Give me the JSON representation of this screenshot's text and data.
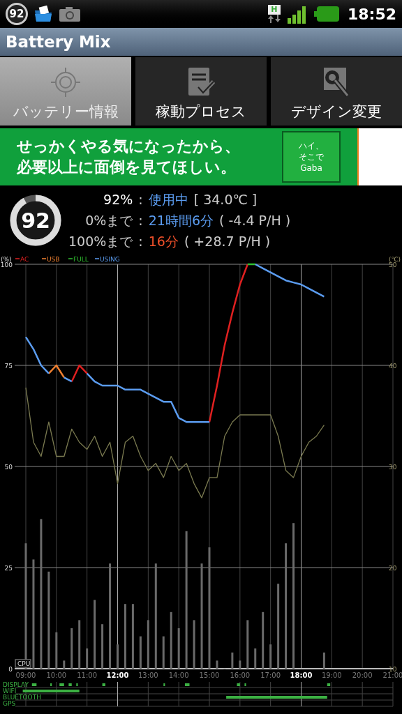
{
  "status_bar": {
    "battery_badge": "92",
    "network_badge": "H",
    "time": "18:52"
  },
  "app_bar": {
    "title": "Battery Mix"
  },
  "tabs": [
    {
      "label": "バッテリー情報",
      "selected": true,
      "kind": "target"
    },
    {
      "label": "稼動プロセス",
      "selected": false,
      "kind": "checklist"
    },
    {
      "label": "デザイン変更",
      "selected": false,
      "kind": "wrench"
    }
  ],
  "ad": {
    "lines": [
      "せっかくやる気になったから、",
      "必要以上に面倒を見てほしい。"
    ],
    "box_lines": [
      "ハイ、",
      "そこで",
      "Gaba"
    ]
  },
  "info": {
    "gauge": {
      "value": "92",
      "level": 0.92
    },
    "rows": [
      {
        "label": "92%",
        "separator": ":",
        "value": "使用中",
        "color": "#5b9cf0",
        "detail": "[ 34.0℃ ]"
      },
      {
        "label": "0%まで",
        "separator": ":",
        "value": "21時間6分",
        "color": "#5b9cf0",
        "detail": "( -4.4 P/H )"
      },
      {
        "label": "100%まで",
        "separator": ":",
        "value": "16分",
        "color": "#f0502a",
        "detail": "( +28.7 P/H )"
      }
    ]
  },
  "chart": {
    "ylabel": "(%)",
    "y2label": "(℃)",
    "lanes": [
      "DISPLAY",
      "WIFI",
      "BLUETOOTH",
      "GPS"
    ],
    "chart_data": {
      "type": "line",
      "grid": true,
      "legend": "top-left",
      "xlim": [
        9,
        21
      ],
      "ylim": [
        0,
        100
      ],
      "y2lim": [
        10,
        50
      ],
      "yticks": [
        0,
        25,
        50,
        75,
        100
      ],
      "y2ticks": [
        10,
        20,
        30,
        40,
        50
      ],
      "xticks": [
        {
          "value": 9,
          "label": "09:00"
        },
        {
          "value": 10,
          "label": "10:00"
        },
        {
          "value": 11,
          "label": "11:00"
        },
        {
          "value": 12,
          "label": "12:00"
        },
        {
          "value": 13,
          "label": "13:00"
        },
        {
          "value": 14,
          "label": "14:00"
        },
        {
          "value": 15,
          "label": "15:00"
        },
        {
          "value": 16,
          "label": "16:00"
        },
        {
          "value": 17,
          "label": "17:00"
        },
        {
          "value": 18,
          "label": "18:00"
        },
        {
          "value": 19,
          "label": "19:00"
        },
        {
          "value": 20,
          "label": "20:00"
        },
        {
          "value": 21,
          "label": "21:00"
        }
      ],
      "x": [
        9,
        9.25,
        9.5,
        9.75,
        10,
        10.25,
        10.5,
        10.75,
        11,
        11.25,
        11.5,
        11.75,
        12,
        12.25,
        12.5,
        12.75,
        13,
        13.25,
        13.5,
        13.75,
        14,
        14.25,
        14.5,
        14.75,
        15,
        15.25,
        15.5,
        15.75,
        16,
        16.25,
        16.5,
        16.75,
        17,
        17.25,
        17.5,
        17.75,
        18,
        18.25,
        18.5,
        18.75
      ],
      "series": [
        {
          "name": "AC",
          "color": "#e02020",
          "values": [
            null,
            null,
            null,
            null,
            null,
            null,
            71,
            75,
            73,
            null,
            null,
            null,
            null,
            null,
            null,
            null,
            null,
            null,
            null,
            null,
            null,
            null,
            null,
            null,
            61,
            70,
            80,
            88,
            95,
            100,
            null,
            null,
            null,
            null,
            null,
            null,
            null,
            null,
            null,
            null
          ]
        },
        {
          "name": "USB",
          "color": "#f08030",
          "values": [
            null,
            null,
            null,
            73,
            75,
            72,
            null,
            null,
            null,
            null,
            null,
            null,
            null,
            null,
            null,
            null,
            null,
            null,
            null,
            null,
            null,
            null,
            null,
            null,
            null,
            null,
            null,
            null,
            null,
            null,
            null,
            null,
            null,
            null,
            null,
            null,
            null,
            null,
            null,
            null
          ]
        },
        {
          "name": "FULL",
          "color": "#30c030",
          "values": [
            null,
            null,
            null,
            null,
            null,
            null,
            null,
            null,
            null,
            null,
            null,
            null,
            null,
            null,
            null,
            null,
            null,
            null,
            null,
            null,
            null,
            null,
            null,
            null,
            null,
            null,
            null,
            null,
            null,
            100,
            100,
            null,
            null,
            null,
            null,
            null,
            null,
            null,
            null,
            null
          ]
        },
        {
          "name": "USING",
          "color": "#5b9cf0",
          "values": [
            82,
            79,
            75,
            73,
            null,
            72,
            71,
            null,
            73,
            71,
            70,
            70,
            70,
            69,
            69,
            69,
            68,
            67,
            66,
            66,
            62,
            61,
            61,
            61,
            61,
            null,
            null,
            null,
            null,
            null,
            100,
            99,
            98,
            97,
            96,
            95.5,
            95,
            94,
            93,
            92
          ]
        },
        {
          "name": "CPU",
          "color": "#6a6a6a",
          "type": "bar",
          "values": [
            31,
            27,
            37,
            24,
            9,
            2,
            10,
            12,
            5,
            17,
            11,
            26,
            6,
            16,
            16,
            8,
            12,
            26,
            8,
            14,
            10,
            34,
            12,
            26,
            30,
            2,
            0,
            4,
            2,
            12,
            5,
            14,
            6,
            21,
            31,
            36,
            null,
            null,
            null,
            4
          ]
        },
        {
          "color": "#7a7a50",
          "axis": "y2",
          "values": [
            37.8,
            32.4,
            31.0,
            34.4,
            31.0,
            31.0,
            33.7,
            32.4,
            31.7,
            33.0,
            31.0,
            32.4,
            28.3,
            32.4,
            33.0,
            31.0,
            29.6,
            30.3,
            28.9,
            31.0,
            29.6,
            30.3,
            28.3,
            26.9,
            28.9,
            28.9,
            33.0,
            34.4,
            35.1,
            35.1,
            35.1,
            35.1,
            35.1,
            33.0,
            29.6,
            28.9,
            31.0,
            32.4,
            33.0,
            34.1
          ]
        }
      ]
    }
  }
}
